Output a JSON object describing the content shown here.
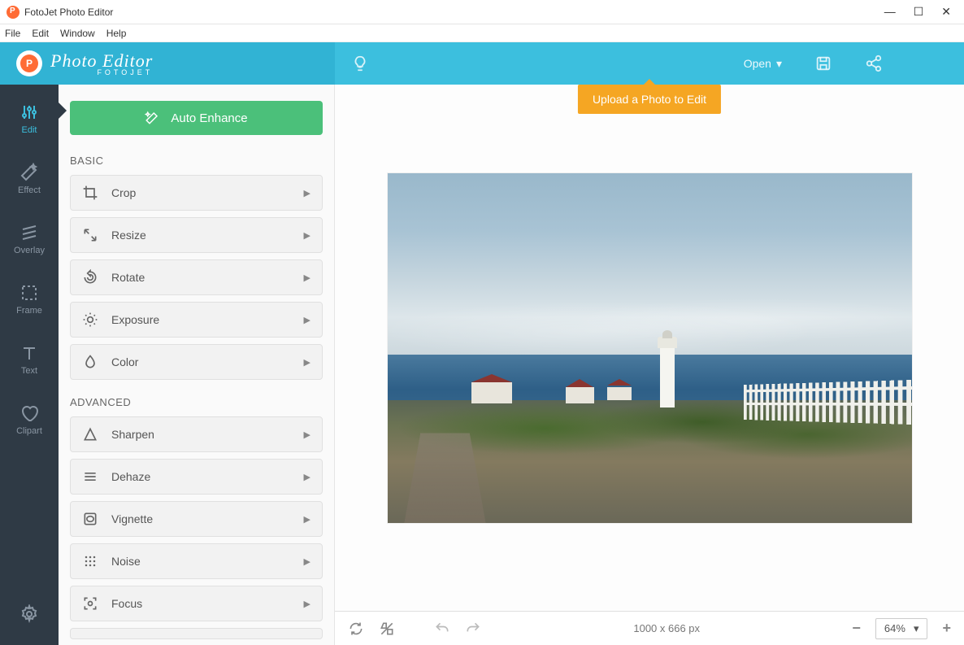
{
  "window": {
    "title": "FotoJet Photo Editor",
    "menus": [
      "File",
      "Edit",
      "Window",
      "Help"
    ]
  },
  "brand": {
    "line1": "Photo Editor",
    "line2": "FOTOJET"
  },
  "appbar": {
    "open_label": "Open",
    "tooltip": "Upload a Photo to Edit"
  },
  "sidenav": {
    "items": [
      {
        "label": "Edit"
      },
      {
        "label": "Effect"
      },
      {
        "label": "Overlay"
      },
      {
        "label": "Frame"
      },
      {
        "label": "Text"
      },
      {
        "label": "Clipart"
      }
    ]
  },
  "panel": {
    "auto_enhance": "Auto Enhance",
    "basic_label": "BASIC",
    "advanced_label": "ADVANCED",
    "basic": [
      {
        "label": "Crop"
      },
      {
        "label": "Resize"
      },
      {
        "label": "Rotate"
      },
      {
        "label": "Exposure"
      },
      {
        "label": "Color"
      }
    ],
    "advanced": [
      {
        "label": "Sharpen"
      },
      {
        "label": "Dehaze"
      },
      {
        "label": "Vignette"
      },
      {
        "label": "Noise"
      },
      {
        "label": "Focus"
      }
    ]
  },
  "statusbar": {
    "dimensions": "1000 x 666 px",
    "zoom": "64%"
  }
}
